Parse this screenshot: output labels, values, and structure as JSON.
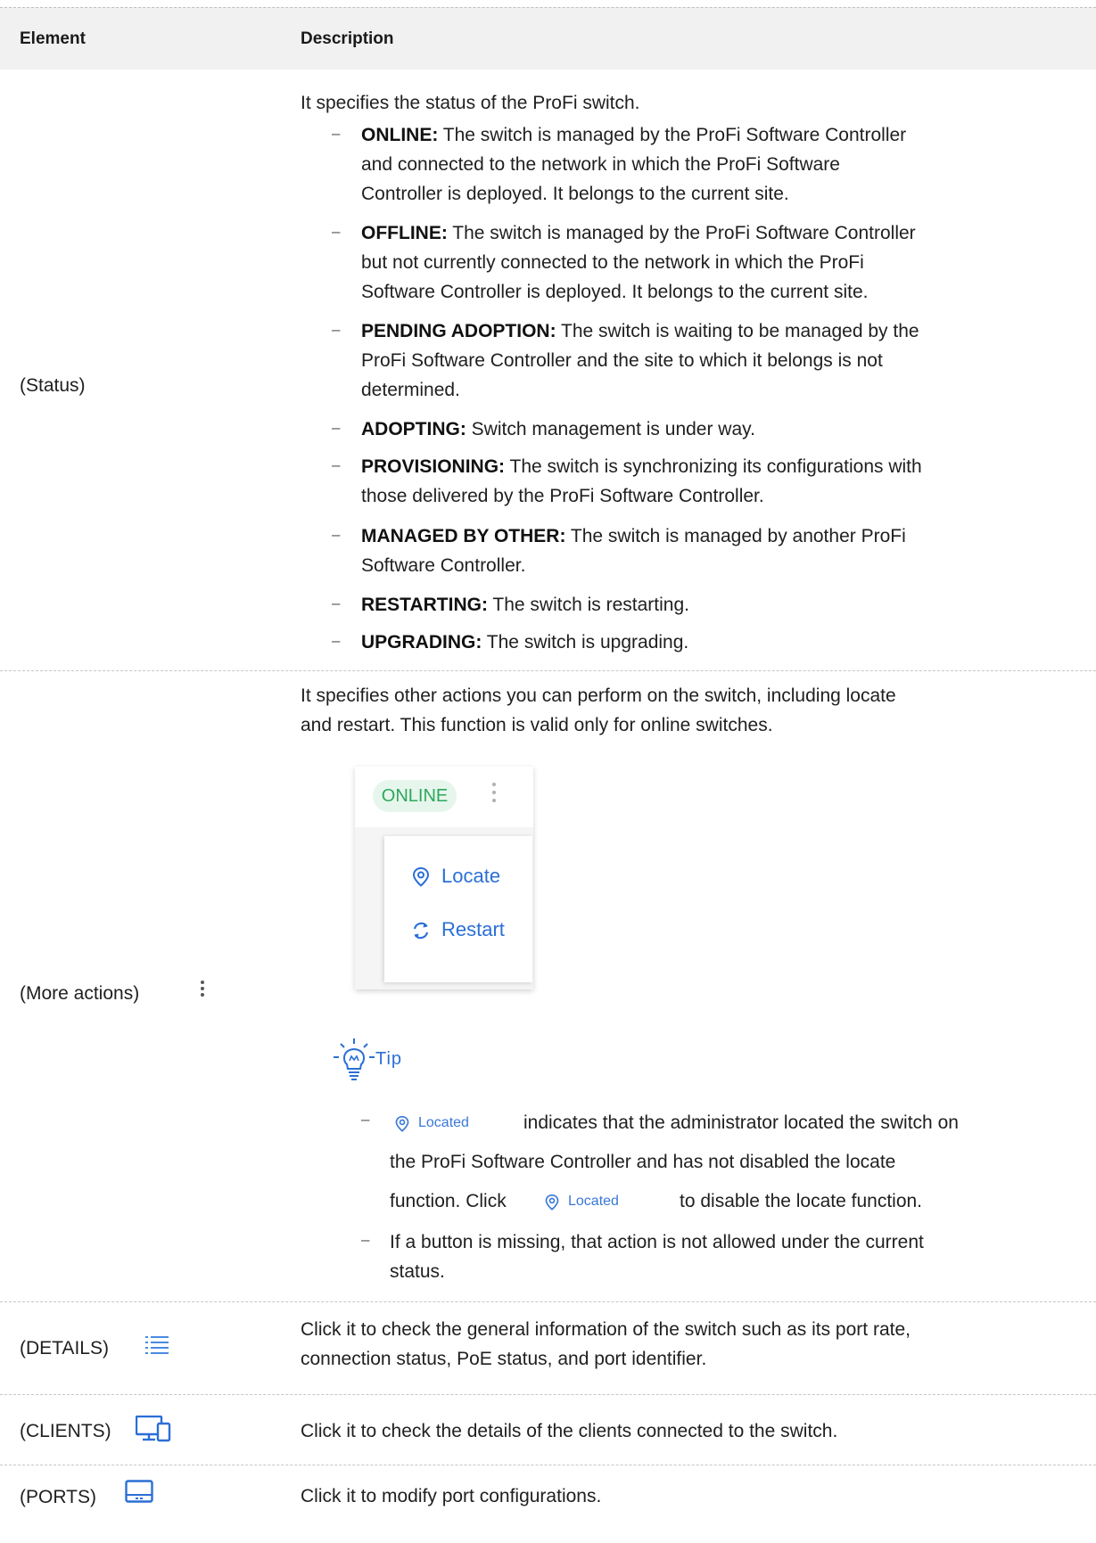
{
  "table": {
    "headers": {
      "element": "Element",
      "description": "Description"
    },
    "status_row": {
      "element_label": "(Status)",
      "intro": "It specifies the status of the ProFi switch.",
      "items": [
        {
          "term": "ONLINE:",
          "lines": [
            " The switch is managed by the ProFi Software Controller",
            "and connected to the network in which the ProFi Software",
            "Controller is deployed. It belongs to the current site."
          ]
        },
        {
          "term": "OFFLINE:",
          "lines": [
            " The switch is managed by the ProFi Software Controller",
            "but not currently connected to the network in which the ProFi",
            "Software Controller is deployed. It belongs to the current site."
          ]
        },
        {
          "term": "PENDING ADOPTION:",
          "lines": [
            " The switch is waiting to be managed by the",
            "ProFi Software Controller and the site to which it belongs is not",
            "determined."
          ]
        },
        {
          "term": "ADOPTING:",
          "lines": [
            " Switch management is under way."
          ]
        },
        {
          "term": "PROVISIONING:",
          "lines": [
            " The switch is synchronizing its configurations with",
            "those delivered by the ProFi Software Controller."
          ]
        },
        {
          "term": "MANAGED BY OTHER:",
          "lines": [
            " The switch is managed by another ProFi",
            "Software Controller."
          ]
        },
        {
          "term": "RESTARTING:",
          "lines": [
            " The switch is restarting."
          ]
        },
        {
          "term": "UPGRADING:",
          "lines": [
            " The switch is upgrading."
          ]
        }
      ],
      "bullet": "–"
    },
    "more_actions_row": {
      "element_label": "(More actions)",
      "element_icon": "more-vertical-icon",
      "intro_lines": [
        "It specifies other actions you can perform on the switch, including locate",
        "and restart. This function is valid only for online switches."
      ],
      "screenshot": {
        "status_pill": "ONLINE",
        "status_color": "#2fa75c",
        "menu_items": [
          {
            "label": "Locate",
            "icon": "location-pin-icon"
          },
          {
            "label": "Restart",
            "icon": "refresh-icon"
          }
        ],
        "accent": "#2a6fd6"
      },
      "tip": {
        "title": "Tip",
        "icon": "lightbulb-icon",
        "bullet1_lines": [
          "indicates that the administrator located the switch on",
          "the ProFi Software Controller and has not disabled the locate",
          "function. Click",
          "to disable the locate function."
        ],
        "located_badge": "Located",
        "bullet2_lines": [
          "If a button is missing, that action is not allowed under the current",
          "status."
        ]
      }
    },
    "details_row": {
      "element_label": "(DETAILS)",
      "element_icon": "list-icon",
      "lines": [
        "Click it to check the general information of the switch such as its port rate,",
        "connection status, PoE status, and port identifier."
      ]
    },
    "clients_row": {
      "element_label": "(CLIENTS)",
      "element_icon": "devices-icon",
      "lines": [
        "Click it to check the details of the clients connected to the switch."
      ]
    },
    "ports_row": {
      "element_label": "(PORTS)",
      "element_icon": "switch-device-icon",
      "lines": [
        "Click it to modify port configurations."
      ]
    }
  }
}
